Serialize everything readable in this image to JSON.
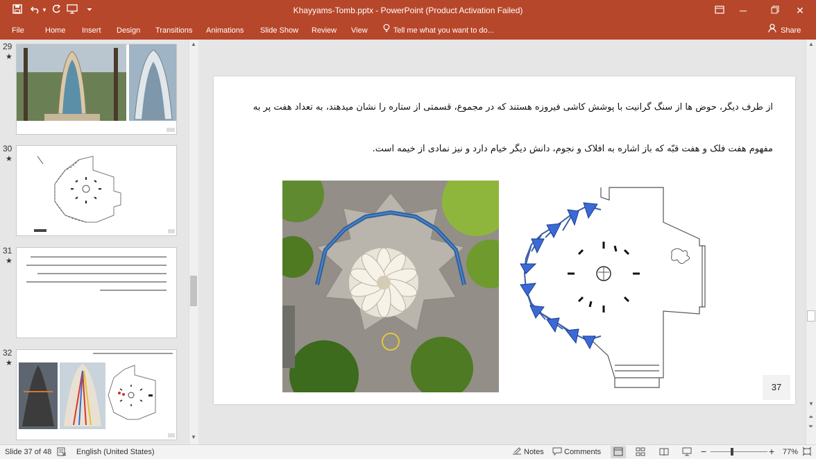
{
  "window": {
    "title": "Khayyams-Tomb.pptx - PowerPoint (Product Activation Failed)",
    "accent": "#b7472a"
  },
  "quick_access": [
    "save-icon",
    "undo-icon",
    "redo-icon",
    "present-icon",
    "customize-icon"
  ],
  "ribbon": {
    "tabs": [
      "File",
      "Home",
      "Insert",
      "Design",
      "Transitions",
      "Animations",
      "Slide Show",
      "Review",
      "View"
    ],
    "tell_me": "Tell me what you want to do...",
    "share": "Share"
  },
  "thumbnails": [
    {
      "number": "29",
      "star": "★"
    },
    {
      "number": "30",
      "star": "★"
    },
    {
      "number": "31",
      "star": "★"
    },
    {
      "number": "32",
      "star": "★"
    }
  ],
  "slide": {
    "paragraph_line1": "از طرف دیگر، حوض ها از سنگ گرانیت با پوشش کاشی فیروزه هستند که در مجموع، قسمتی از ستاره را نشان میدهند، به تعداد هفت پر به",
    "paragraph_line2": "مفهوم هفت فلک و هفت قبّه که باز اشاره به افلاک و نجوم، دانش دیگر خیام دارد و نیز نمادی از خیمه است.",
    "number": "37"
  },
  "status": {
    "slide_indicator": "Slide 37 of 48",
    "language": "English (United States)",
    "notes": "Notes",
    "comments": "Comments",
    "zoom": "77%",
    "zoom_level": 0.77
  }
}
